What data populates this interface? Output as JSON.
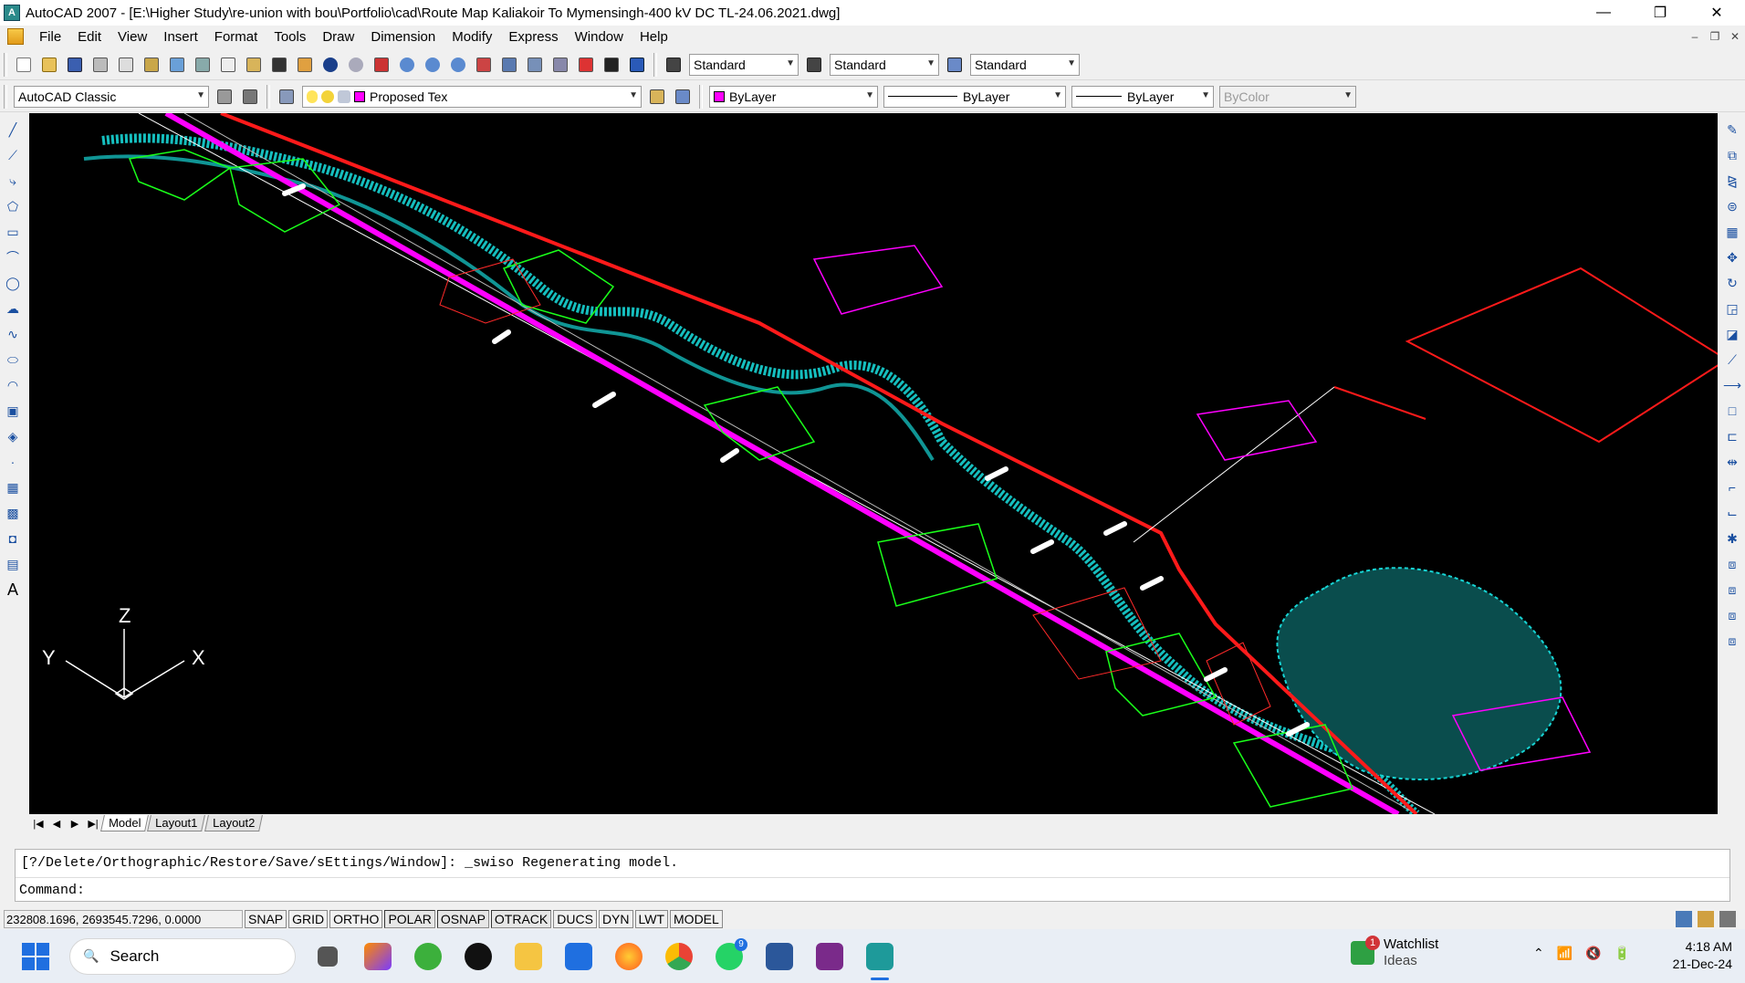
{
  "window": {
    "title": "AutoCAD 2007 - [E:\\Higher Study\\re-union with bou\\Portfolio\\cad\\Route Map Kaliakoir To Mymensingh-400 kV DC TL-24.06.2021.dwg]",
    "controls": [
      "—",
      "❐",
      "✕"
    ]
  },
  "menu": [
    "File",
    "Edit",
    "View",
    "Insert",
    "Format",
    "Tools",
    "Draw",
    "Dimension",
    "Modify",
    "Express",
    "Window",
    "Help"
  ],
  "toolbar1": {
    "text_style": "Standard",
    "dim_style": "Standard",
    "table_style": "Standard"
  },
  "toolbar2": {
    "workspace": "AutoCAD Classic",
    "layer": "Proposed Tex",
    "color": "ByLayer",
    "linetype": "ByLayer",
    "lineweight": "ByLayer",
    "plotstyle": "ByColor",
    "accent_color": "#ff00ff"
  },
  "ucs": {
    "z": "Z",
    "y": "Y",
    "x": "X"
  },
  "tabs": [
    "Model",
    "Layout1",
    "Layout2"
  ],
  "tab_nav": [
    "|◀",
    "◀",
    "▶",
    "▶|"
  ],
  "command": {
    "history": "[?/Delete/Orthographic/Restore/Save/sEttings/Window]: _swiso Regenerating model.",
    "prompt": "Command:"
  },
  "status": {
    "coords": "232808.1696, 2693545.7296, 0.0000",
    "buttons": [
      "SNAP",
      "GRID",
      "ORTHO",
      "POLAR",
      "OSNAP",
      "OTRACK",
      "DUCS",
      "DYN",
      "LWT",
      "MODEL"
    ]
  },
  "taskbar": {
    "search": "Search",
    "whatsapp_badge": "9",
    "watchlist": {
      "title": "Watchlist",
      "sub": "Ideas",
      "badge": "1"
    },
    "time": "4:18 AM",
    "date": "21-Dec-24"
  }
}
